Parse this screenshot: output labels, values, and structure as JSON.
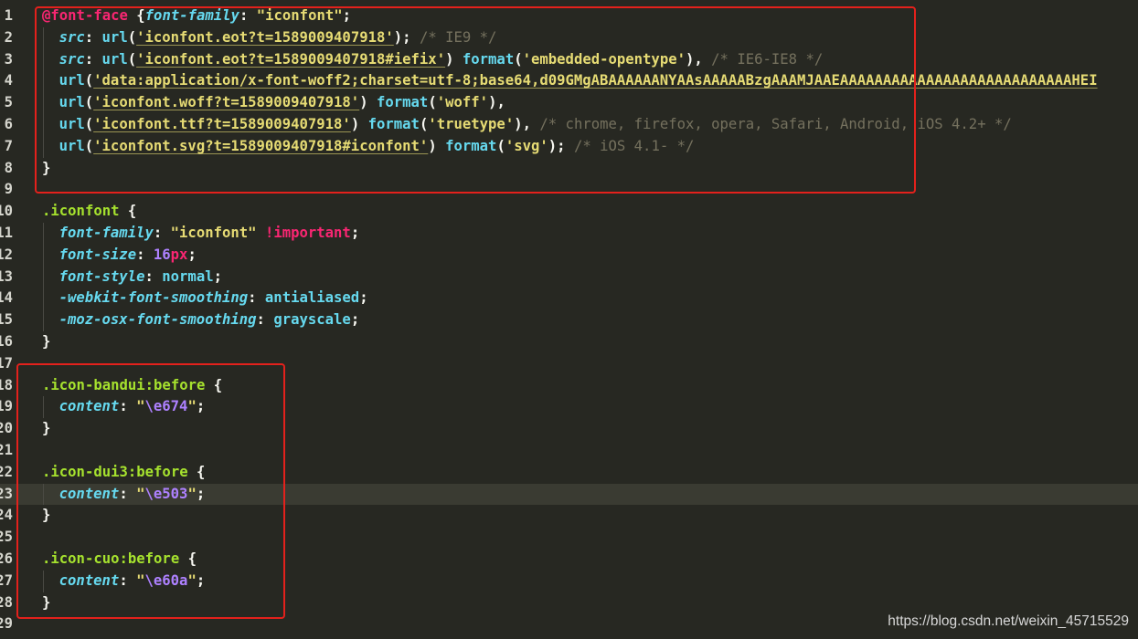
{
  "editor": {
    "current_line": 23,
    "lines": [
      {
        "n": "1",
        "indent": 0,
        "tokens": [
          {
            "c": "at",
            "t": "@font-face"
          },
          {
            "c": "txt",
            "t": " {"
          },
          {
            "c": "prop",
            "t": "font-family"
          },
          {
            "c": "txt",
            "t": ": "
          },
          {
            "c": "str",
            "t": "\"iconfont\""
          },
          {
            "c": "txt",
            "t": ";"
          }
        ]
      },
      {
        "n": "2",
        "indent": 1,
        "tokens": [
          {
            "c": "prop",
            "t": "src"
          },
          {
            "c": "txt",
            "t": ": "
          },
          {
            "c": "fn",
            "t": "url"
          },
          {
            "c": "txt",
            "t": "("
          },
          {
            "c": "strul",
            "t": "'iconfont.eot?t=1589009407918'"
          },
          {
            "c": "txt",
            "t": "); "
          },
          {
            "c": "cm",
            "t": "/* IE9 */"
          }
        ]
      },
      {
        "n": "3",
        "indent": 1,
        "tokens": [
          {
            "c": "prop",
            "t": "src"
          },
          {
            "c": "txt",
            "t": ": "
          },
          {
            "c": "fn",
            "t": "url"
          },
          {
            "c": "txt",
            "t": "("
          },
          {
            "c": "strul",
            "t": "'iconfont.eot?t=1589009407918#iefix'"
          },
          {
            "c": "txt",
            "t": ") "
          },
          {
            "c": "fn",
            "t": "format"
          },
          {
            "c": "txt",
            "t": "("
          },
          {
            "c": "str",
            "t": "'embedded-opentype'"
          },
          {
            "c": "txt",
            "t": "), "
          },
          {
            "c": "cm",
            "t": "/* IE6-IE8 */"
          }
        ]
      },
      {
        "n": "4",
        "indent": 1,
        "tokens": [
          {
            "c": "fn",
            "t": "url"
          },
          {
            "c": "txt",
            "t": "("
          },
          {
            "c": "strul",
            "t": "'data:application/x-font-woff2;charset=utf-8;base64,d09GMgABAAAAAANYAAsAAAAABzgAAAMJAAEAAAAAAAAAAAAAAAAAAAAAAAAAAAHEI"
          }
        ]
      },
      {
        "n": "5",
        "indent": 1,
        "tokens": [
          {
            "c": "fn",
            "t": "url"
          },
          {
            "c": "txt",
            "t": "("
          },
          {
            "c": "strul",
            "t": "'iconfont.woff?t=1589009407918'"
          },
          {
            "c": "txt",
            "t": ") "
          },
          {
            "c": "fn",
            "t": "format"
          },
          {
            "c": "txt",
            "t": "("
          },
          {
            "c": "str",
            "t": "'woff'"
          },
          {
            "c": "txt",
            "t": "),"
          }
        ]
      },
      {
        "n": "6",
        "indent": 1,
        "tokens": [
          {
            "c": "fn",
            "t": "url"
          },
          {
            "c": "txt",
            "t": "("
          },
          {
            "c": "strul",
            "t": "'iconfont.ttf?t=1589009407918'"
          },
          {
            "c": "txt",
            "t": ") "
          },
          {
            "c": "fn",
            "t": "format"
          },
          {
            "c": "txt",
            "t": "("
          },
          {
            "c": "str",
            "t": "'truetype'"
          },
          {
            "c": "txt",
            "t": "), "
          },
          {
            "c": "cm",
            "t": "/* chrome, firefox, opera, Safari, Android, iOS 4.2+ */"
          }
        ]
      },
      {
        "n": "7",
        "indent": 1,
        "tokens": [
          {
            "c": "fn",
            "t": "url"
          },
          {
            "c": "txt",
            "t": "("
          },
          {
            "c": "strul",
            "t": "'iconfont.svg?t=1589009407918#iconfont'"
          },
          {
            "c": "txt",
            "t": ") "
          },
          {
            "c": "fn",
            "t": "format"
          },
          {
            "c": "txt",
            "t": "("
          },
          {
            "c": "str",
            "t": "'svg'"
          },
          {
            "c": "txt",
            "t": "); "
          },
          {
            "c": "cm",
            "t": "/* iOS 4.1- */"
          }
        ]
      },
      {
        "n": "8",
        "indent": 0,
        "tokens": [
          {
            "c": "txt",
            "t": "}"
          }
        ]
      },
      {
        "n": "9",
        "indent": 0,
        "tokens": []
      },
      {
        "n": "10",
        "indent": 0,
        "tokens": [
          {
            "c": "sel",
            "t": ".iconfont"
          },
          {
            "c": "txt",
            "t": " {"
          }
        ]
      },
      {
        "n": "11",
        "indent": 1,
        "tokens": [
          {
            "c": "prop",
            "t": "font-family"
          },
          {
            "c": "txt",
            "t": ": "
          },
          {
            "c": "str",
            "t": "\"iconfont\""
          },
          {
            "c": "txt",
            "t": " "
          },
          {
            "c": "imp",
            "t": "!important"
          },
          {
            "c": "txt",
            "t": ";"
          }
        ]
      },
      {
        "n": "12",
        "indent": 1,
        "tokens": [
          {
            "c": "prop",
            "t": "font-size"
          },
          {
            "c": "txt",
            "t": ": "
          },
          {
            "c": "num",
            "t": "16"
          },
          {
            "c": "unit",
            "t": "px"
          },
          {
            "c": "txt",
            "t": ";"
          }
        ]
      },
      {
        "n": "13",
        "indent": 1,
        "tokens": [
          {
            "c": "prop",
            "t": "font-style"
          },
          {
            "c": "txt",
            "t": ": "
          },
          {
            "c": "val",
            "t": "normal"
          },
          {
            "c": "txt",
            "t": ";"
          }
        ]
      },
      {
        "n": "14",
        "indent": 1,
        "tokens": [
          {
            "c": "prop",
            "t": "-webkit-font-smoothing"
          },
          {
            "c": "txt",
            "t": ": "
          },
          {
            "c": "val",
            "t": "antialiased"
          },
          {
            "c": "txt",
            "t": ";"
          }
        ]
      },
      {
        "n": "15",
        "indent": 1,
        "tokens": [
          {
            "c": "prop",
            "t": "-moz-osx-font-smoothing"
          },
          {
            "c": "txt",
            "t": ": "
          },
          {
            "c": "val",
            "t": "grayscale"
          },
          {
            "c": "txt",
            "t": ";"
          }
        ]
      },
      {
        "n": "16",
        "indent": 0,
        "tokens": [
          {
            "c": "txt",
            "t": "}"
          }
        ]
      },
      {
        "n": "17",
        "indent": 0,
        "tokens": []
      },
      {
        "n": "18",
        "indent": 0,
        "tokens": [
          {
            "c": "sel",
            "t": ".icon-bandui:before"
          },
          {
            "c": "txt",
            "t": " {"
          }
        ]
      },
      {
        "n": "19",
        "indent": 1,
        "tokens": [
          {
            "c": "prop",
            "t": "content"
          },
          {
            "c": "txt",
            "t": ": "
          },
          {
            "c": "str",
            "t": "\""
          },
          {
            "c": "esc",
            "t": "\\e674"
          },
          {
            "c": "str",
            "t": "\""
          },
          {
            "c": "txt",
            "t": ";"
          }
        ]
      },
      {
        "n": "20",
        "indent": 0,
        "tokens": [
          {
            "c": "txt",
            "t": "}"
          }
        ]
      },
      {
        "n": "21",
        "indent": 0,
        "tokens": []
      },
      {
        "n": "22",
        "indent": 0,
        "tokens": [
          {
            "c": "sel",
            "t": ".icon-dui3:before"
          },
          {
            "c": "txt",
            "t": " {"
          }
        ]
      },
      {
        "n": "23",
        "indent": 1,
        "tokens": [
          {
            "c": "prop",
            "t": "content"
          },
          {
            "c": "txt",
            "t": ": "
          },
          {
            "c": "str",
            "t": "\""
          },
          {
            "c": "esc",
            "t": "\\e503"
          },
          {
            "c": "str",
            "t": "\""
          },
          {
            "c": "txt",
            "t": ";"
          }
        ]
      },
      {
        "n": "24",
        "indent": 0,
        "tokens": [
          {
            "c": "txt",
            "t": "}"
          }
        ]
      },
      {
        "n": "25",
        "indent": 0,
        "tokens": []
      },
      {
        "n": "26",
        "indent": 0,
        "tokens": [
          {
            "c": "sel",
            "t": ".icon-cuo:before"
          },
          {
            "c": "txt",
            "t": " {"
          }
        ]
      },
      {
        "n": "27",
        "indent": 1,
        "tokens": [
          {
            "c": "prop",
            "t": "content"
          },
          {
            "c": "txt",
            "t": ": "
          },
          {
            "c": "str",
            "t": "\""
          },
          {
            "c": "esc",
            "t": "\\e60a"
          },
          {
            "c": "str",
            "t": "\""
          },
          {
            "c": "txt",
            "t": ";"
          }
        ]
      },
      {
        "n": "28",
        "indent": 0,
        "tokens": [
          {
            "c": "txt",
            "t": "}"
          }
        ]
      },
      {
        "n": "29",
        "indent": 0,
        "tokens": []
      }
    ]
  },
  "colors": {
    "background": "#272822",
    "highlight_box": "#e3211c",
    "current_line": "#3a3b32"
  },
  "watermark": "https://blog.csdn.net/weixin_45715529"
}
